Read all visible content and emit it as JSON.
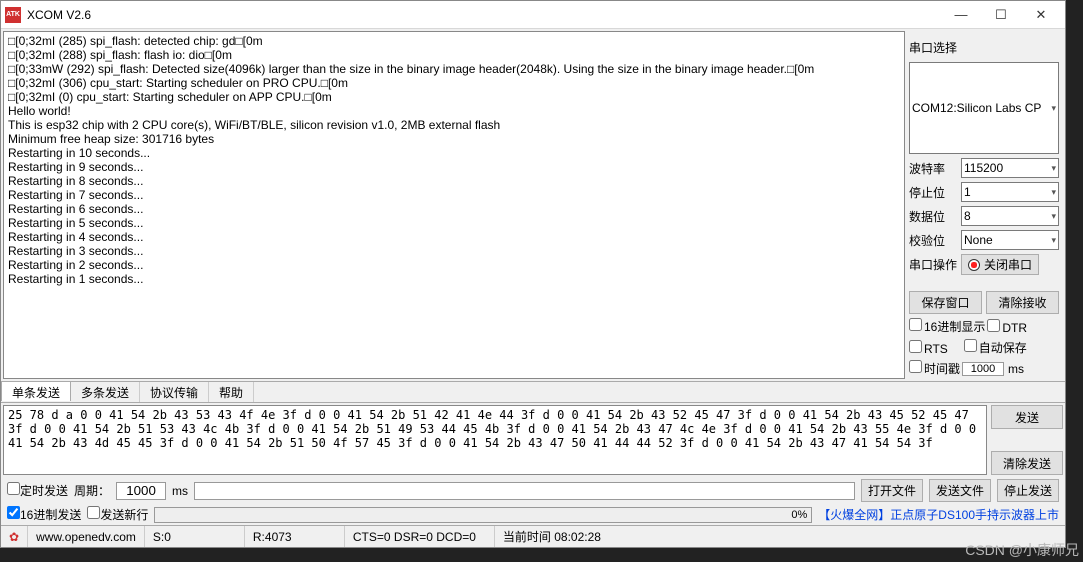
{
  "title": "XCOM V2.6",
  "app_icon_label": "ATK",
  "log_lines": [
    "□[0;32mI (285) spi_flash: detected chip: gd□[0m",
    "□[0;32mI (288) spi_flash: flash io: dio□[0m",
    "□[0;33mW (292) spi_flash: Detected size(4096k) larger than the size in the binary image header(2048k). Using the size in the binary image header.□[0m",
    "□[0;32mI (306) cpu_start: Starting scheduler on PRO CPU.□[0m",
    "□[0;32mI (0) cpu_start: Starting scheduler on APP CPU.□[0m",
    "Hello world!",
    "This is esp32 chip with 2 CPU core(s), WiFi/BT/BLE, silicon revision v1.0, 2MB external flash",
    "Minimum free heap size: 301716 bytes",
    "Restarting in 10 seconds...",
    "Restarting in 9 seconds...",
    "Restarting in 8 seconds...",
    "Restarting in 7 seconds...",
    "Restarting in 6 seconds...",
    "Restarting in 5 seconds...",
    "Restarting in 4 seconds...",
    "Restarting in 3 seconds...",
    "Restarting in 2 seconds...",
    "Restarting in 1 seconds..."
  ],
  "side": {
    "port_title": "串口选择",
    "port_value": "COM12:Silicon Labs CP",
    "baud_label": "波特率",
    "baud_value": "115200",
    "stop_label": "停止位",
    "stop_value": "1",
    "data_label": "数据位",
    "data_value": "8",
    "parity_label": "校验位",
    "parity_value": "None",
    "portop_label": "串口操作",
    "portop_btn": "关闭串口",
    "save_win": "保存窗口",
    "clear_rx": "清除接收",
    "hex_disp": "16进制显示",
    "dtr": "DTR",
    "rts": "RTS",
    "auto_save": "自动保存",
    "timestamp": "时间戳",
    "ts_value": "1000",
    "ts_unit": "ms"
  },
  "tabs": {
    "single": "单条发送",
    "multi": "多条发送",
    "proto": "协议传输",
    "help": "帮助"
  },
  "send_hex": "25 78 d a 0 0 41 54 2b 43 53 43 4f 4e 3f d 0 0 41 54 2b 51 42 41 4e 44 3f d 0 0 41 54 2b 43 52 45 47 3f d 0 0 41 54 2b 43 45 52 45 47 3f d 0 0 41 54 2b 51 53 43 4c 4b 3f d 0 0 41 54 2b 51 49 53 44 45 4b 3f d 0 0 41 54 2b 43 47 4c 4e 3f d 0 0 41 54 2b 43 55 4e 3f d 0 0 41 54 2b 43 4d 45 45 3f d 0 0 41 54 2b 51 50 4f 57 45 3f d 0 0 41 54 2b 43 47 50 41 44 44 52 3f d 0 0 41 54 2b 43 47 41 54 54 3f",
  "send_btn": "发送",
  "clear_send": "清除发送",
  "opts": {
    "timed": "定时发送",
    "period_label": "周期：",
    "period_value": "1000",
    "period_unit": "ms",
    "open_file": "打开文件",
    "send_file": "发送文件",
    "stop_send": "停止发送",
    "hex_send": "16进制发送",
    "send_newline": "发送新行",
    "progress": "0%",
    "promo": "【火爆全网】正点原子DS100手持示波器上市"
  },
  "status": {
    "url": "www.openedv.com",
    "s": "S:0",
    "r": "R:4073",
    "flags": "CTS=0 DSR=0 DCD=0",
    "time": "当前时间 08:02:28"
  },
  "watermark": "CSDN @小康师兄"
}
